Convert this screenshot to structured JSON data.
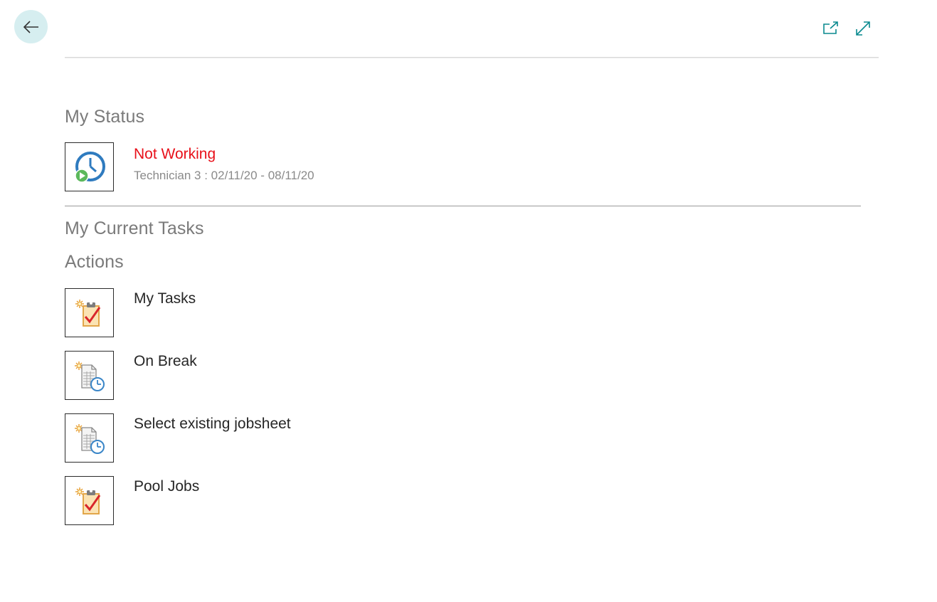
{
  "header": {
    "back_icon": "arrow-left-icon",
    "open_new_window_icon": "open-in-new-window-icon",
    "expand_icon": "expand-icon",
    "accent_color": "#0a8a8f"
  },
  "my_status": {
    "title": "My Status",
    "icon": "clock-play-icon",
    "status": "Not Working",
    "status_color": "#e8101a",
    "detail": "Technician 3 : 02/11/20 - 08/11/20"
  },
  "current_tasks": {
    "title": "My Current Tasks"
  },
  "actions": {
    "title": "Actions",
    "items": [
      {
        "label": "My Tasks",
        "icon": "task-clipboard-icon"
      },
      {
        "label": "On Break",
        "icon": "timesheet-clock-icon"
      },
      {
        "label": "Select existing jobsheet",
        "icon": "timesheet-clock-icon"
      },
      {
        "label": "Pool Jobs",
        "icon": "task-clipboard-icon"
      }
    ]
  }
}
